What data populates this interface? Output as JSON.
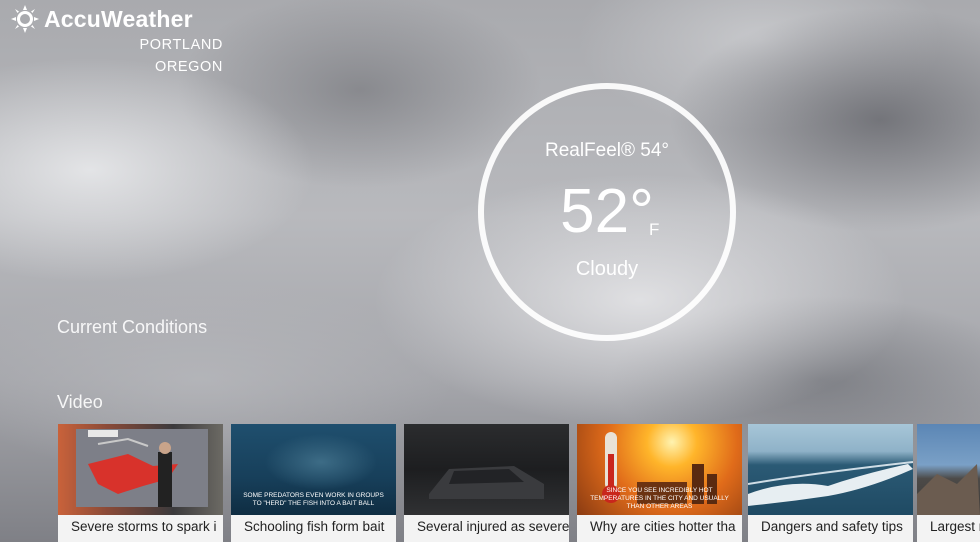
{
  "app": {
    "name": "AccuWeather",
    "logo_icon": "sun-logo-icon"
  },
  "location": {
    "city": "PORTLAND",
    "state": "OREGON"
  },
  "current": {
    "realfeel": "RealFeel® 54°",
    "temperature": "52°",
    "unit": "F",
    "condition": "Cloudy"
  },
  "sections": {
    "current_conditions": "Current Conditions",
    "video": "Video"
  },
  "videos": [
    {
      "caption": "Severe storms to spark i",
      "overlay": ""
    },
    {
      "caption": "Schooling fish form bait",
      "overlay": "SOME PREDATORS EVEN WORK IN GROUPS TO \"HERD\" THE FISH INTO A BAIT BALL"
    },
    {
      "caption": "Several injured as severe",
      "overlay": ""
    },
    {
      "caption": "Why are cities hotter tha",
      "overlay": "SINCE YOU SEE INCREDIBLY HOT TEMPERATURES IN THE CITY AND USUALLY THAN OTHER AREAS"
    },
    {
      "caption": "Dangers and safety tips",
      "overlay": ""
    },
    {
      "caption": "Largest m",
      "overlay": ""
    }
  ],
  "colors": {
    "ring": "#ffffff",
    "card_bg": "#f3f3f3"
  }
}
